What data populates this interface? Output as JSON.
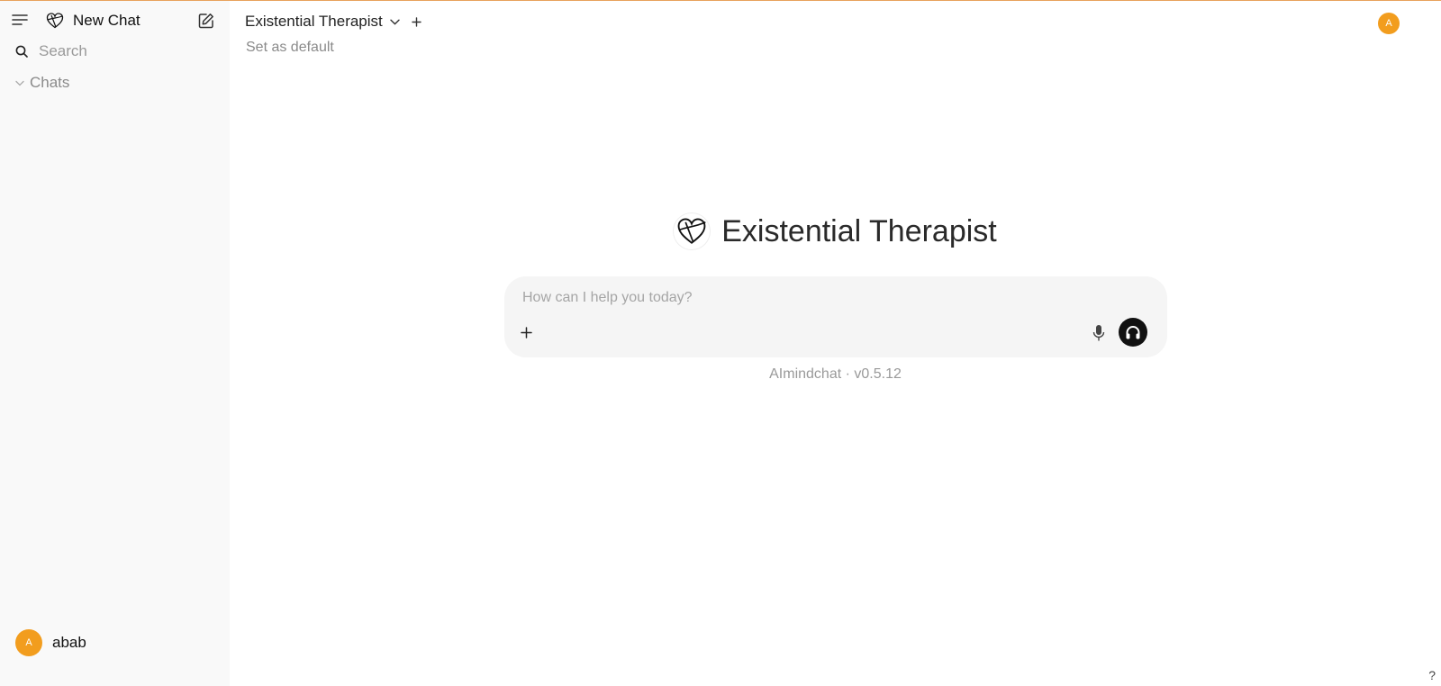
{
  "sidebar": {
    "new_chat_label": "New Chat",
    "search_placeholder": "Search",
    "chats_section_label": "Chats",
    "user": {
      "avatar_initial": "A",
      "name": "abab"
    }
  },
  "header": {
    "model_name": "Existential Therapist",
    "set_default_label": "Set as default",
    "avatar_initial": "A"
  },
  "hero": {
    "title": "Existential Therapist"
  },
  "composer": {
    "placeholder": "How can I help you today?"
  },
  "footer": {
    "version_text": "AImindchat · v0.5.12"
  },
  "help_label": "?",
  "colors": {
    "accent_orange": "#f29d1e",
    "sidebar_bg": "#f9f9f9",
    "composer_bg": "#f5f5f5"
  },
  "icons": [
    "menu-icon",
    "heart-logo-icon",
    "edit-icon",
    "search-icon",
    "chevron-down-icon",
    "plus-icon",
    "microphone-icon",
    "headphones-icon"
  ]
}
